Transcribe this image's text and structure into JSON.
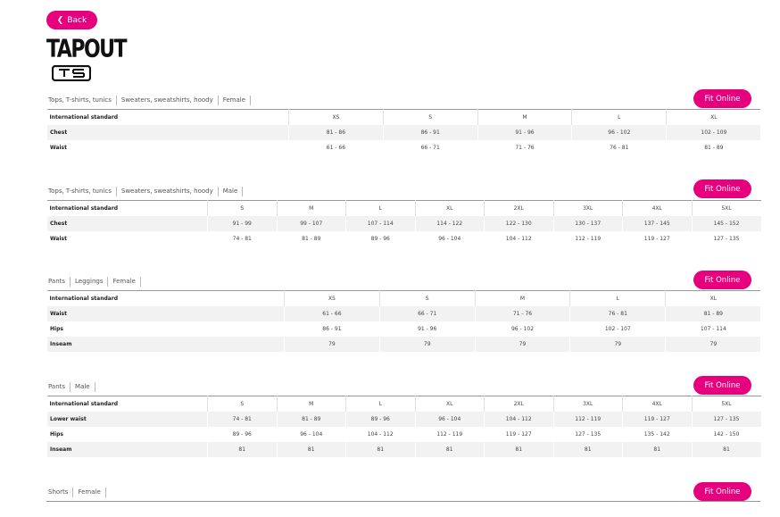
{
  "back_label": "Back",
  "fit_label": "Fit Online",
  "logo_text": "TAPOUT",
  "sections": [
    {
      "cats": [
        "Tops, T-shirts, tunics",
        "Sweaters, sweatshirts, hoody",
        "Female"
      ],
      "rows": [
        [
          "International standard",
          "XS",
          "S",
          "M",
          "L",
          "XL"
        ],
        [
          "Chest",
          "81 - 86",
          "86 - 91",
          "91 - 96",
          "96 - 102",
          "102 - 109"
        ],
        [
          "Waist",
          "61 - 66",
          "66 - 71",
          "71 - 76",
          "76 - 81",
          "81 - 89"
        ]
      ]
    },
    {
      "cats": [
        "Tops, T-shirts, tunics",
        "Sweaters, sweatshirts, hoody",
        "Male"
      ],
      "rows": [
        [
          "International standard",
          "S",
          "M",
          "L",
          "XL",
          "2XL",
          "3XL",
          "4XL",
          "5XL"
        ],
        [
          "Chest",
          "91 - 99",
          "99 - 107",
          "107 - 114",
          "114 - 122",
          "122 - 130",
          "130 - 137",
          "137 - 145",
          "145 - 152"
        ],
        [
          "Waist",
          "74 - 81",
          "81 - 89",
          "89 - 96",
          "96 - 104",
          "104 - 112",
          "112 - 119",
          "119 - 127",
          "127 - 135"
        ]
      ]
    },
    {
      "cats": [
        "Pants",
        "Leggings",
        "Female"
      ],
      "rows": [
        [
          "International standard",
          "XS",
          "S",
          "M",
          "L",
          "XL"
        ],
        [
          "Waist",
          "61 - 66",
          "66 - 71",
          "71 - 76",
          "76 - 81",
          "81 - 89"
        ],
        [
          "Hips",
          "86 - 91",
          "91 - 96",
          "96 - 102",
          "102 - 107",
          "107 - 114"
        ],
        [
          "Inseam",
          "79",
          "79",
          "79",
          "79",
          "79"
        ]
      ]
    },
    {
      "cats": [
        "Pants",
        "Male"
      ],
      "rows": [
        [
          "International standard",
          "S",
          "M",
          "L",
          "XL",
          "2XL",
          "3XL",
          "4XL",
          "5XL"
        ],
        [
          "Lower waist",
          "74 - 81",
          "81 - 89",
          "89 - 96",
          "96 - 104",
          "104 - 112",
          "112 - 119",
          "119 - 127",
          "127 - 135"
        ],
        [
          "Hips",
          "89 - 96",
          "96 - 104",
          "104 - 112",
          "112 - 119",
          "119 - 127",
          "127 - 135",
          "135 - 142",
          "142 - 150"
        ],
        [
          "Inseam",
          "81",
          "81",
          "81",
          "81",
          "81",
          "81",
          "81",
          "81"
        ]
      ]
    },
    {
      "cats": [
        "Shorts",
        "Female"
      ],
      "rows": []
    }
  ],
  "colors": {
    "accent": "#e6007e",
    "row_alt": "#f2f2f2"
  },
  "icons": {
    "back": "chevron-left-icon"
  }
}
